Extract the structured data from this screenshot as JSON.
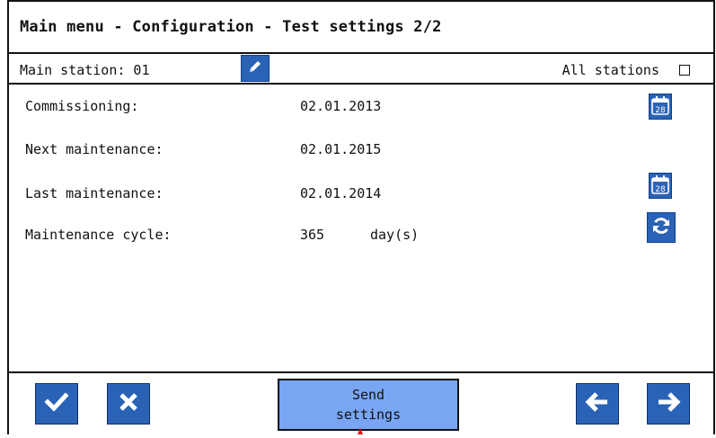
{
  "header": {
    "title": "Main menu - Configuration - Test settings 2/2"
  },
  "station": {
    "label": "Main station: 01",
    "edit_icon": "pencil-icon",
    "all_stations_label": "All stations",
    "all_stations_checked": false
  },
  "rows": [
    {
      "label": "Commissioning:",
      "value": "02.01.2013",
      "unit": "",
      "icon": "calendar-icon",
      "icon_text": "28"
    },
    {
      "label": "Next maintenance:",
      "value": "02.01.2015",
      "unit": "",
      "icon": "",
      "icon_text": ""
    },
    {
      "label": "Last maintenance:",
      "value": "02.01.2014",
      "unit": "",
      "icon": "calendar-icon",
      "icon_text": "28"
    },
    {
      "label": "Maintenance cycle:",
      "value": "365",
      "unit": "day(s)",
      "icon": "refresh-icon",
      "icon_text": ""
    }
  ],
  "footer": {
    "confirm_icon": "check-icon",
    "cancel_icon": "close-icon",
    "send_label_line1": "Send",
    "send_label_line2": "settings",
    "back_icon": "arrow-left-icon",
    "forward_icon": "arrow-right-icon"
  },
  "colors": {
    "button_blue": "#2a63b6",
    "send_button": "#79a6f2",
    "marker": "#e01010"
  }
}
